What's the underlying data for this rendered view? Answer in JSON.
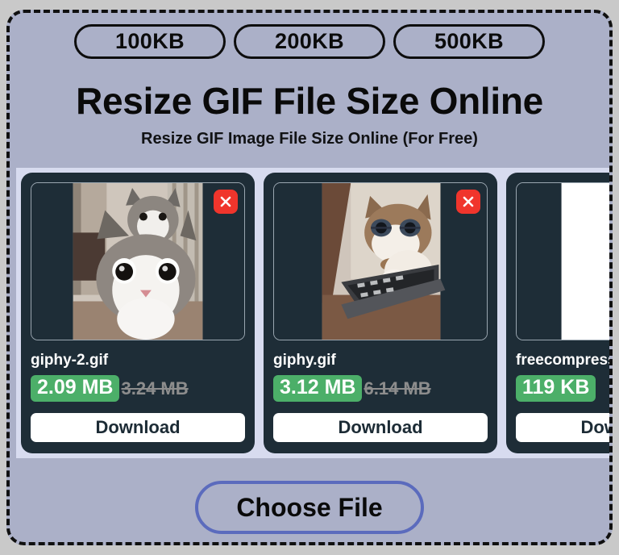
{
  "page": {
    "title": "Resize GIF File Size Online",
    "subtitle": "Resize GIF Image File Size Online (For Free)",
    "background_color": "#c9c9c9",
    "dropzone_color": "#abb0c8",
    "carousel_color": "#d7dbef"
  },
  "size_presets": [
    {
      "label": "100KB"
    },
    {
      "label": "200KB"
    },
    {
      "label": "500KB"
    }
  ],
  "files": [
    {
      "name": "giphy-2.gif",
      "new_size": "2.09 MB",
      "original_size": "3.24 MB",
      "download_label": "Download",
      "close_icon": "close-icon",
      "thumbnail": "cat-pair-photo"
    },
    {
      "name": "giphy.gif",
      "new_size": "3.12 MB",
      "original_size": "6.14 MB",
      "download_label": "Download",
      "close_icon": "close-icon",
      "thumbnail": "cat-laptop-photo"
    },
    {
      "name": "freecompress-",
      "new_size": "119 KB",
      "original_size": "",
      "download_label": "Download",
      "close_icon": "close-icon",
      "thumbnail": "green-shape-graphic"
    }
  ],
  "actions": {
    "choose_file_label": "Choose File"
  },
  "colors": {
    "badge_green": "#4caf69",
    "close_red": "#f0352c",
    "card_dark": "#1e2d37",
    "choose_border_blue": "#5b6bbd",
    "struck_gray": "#8d8d8d"
  }
}
